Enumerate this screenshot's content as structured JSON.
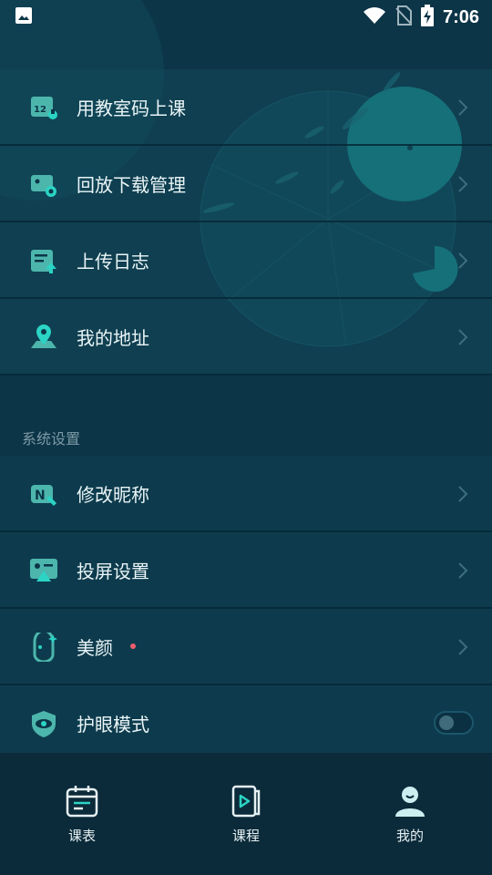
{
  "status_bar": {
    "time": "7:06",
    "icons": [
      "image-icon",
      "wifi-icon",
      "no-sim-icon",
      "battery-charging-icon"
    ]
  },
  "menu_top": [
    {
      "label": "用教室码上课",
      "icon": "classroom-code-icon"
    },
    {
      "label": "回放下载管理",
      "icon": "playback-download-icon"
    },
    {
      "label": "上传日志",
      "icon": "upload-log-icon"
    },
    {
      "label": "我的地址",
      "icon": "location-pin-icon"
    }
  ],
  "settings_section": {
    "title": "系统设置",
    "items": [
      {
        "label": "修改昵称",
        "icon": "nickname-edit-icon"
      },
      {
        "label": "投屏设置",
        "icon": "screen-cast-icon"
      },
      {
        "label": "美颜",
        "icon": "beauty-icon",
        "new_dot": true
      },
      {
        "label": "护眼模式",
        "icon": "eye-shield-icon",
        "toggle_on": false
      }
    ]
  },
  "bottom_nav": [
    {
      "label": "课表",
      "icon": "calendar-icon",
      "active": false
    },
    {
      "label": "课程",
      "icon": "course-play-icon",
      "active": false
    },
    {
      "label": "我的",
      "icon": "profile-icon",
      "active": true
    }
  ],
  "colors": {
    "accent": "#2bd4c4",
    "background": "#0c3547",
    "nav_background": "#0b2a3a",
    "badge": "#ee5d6c"
  }
}
